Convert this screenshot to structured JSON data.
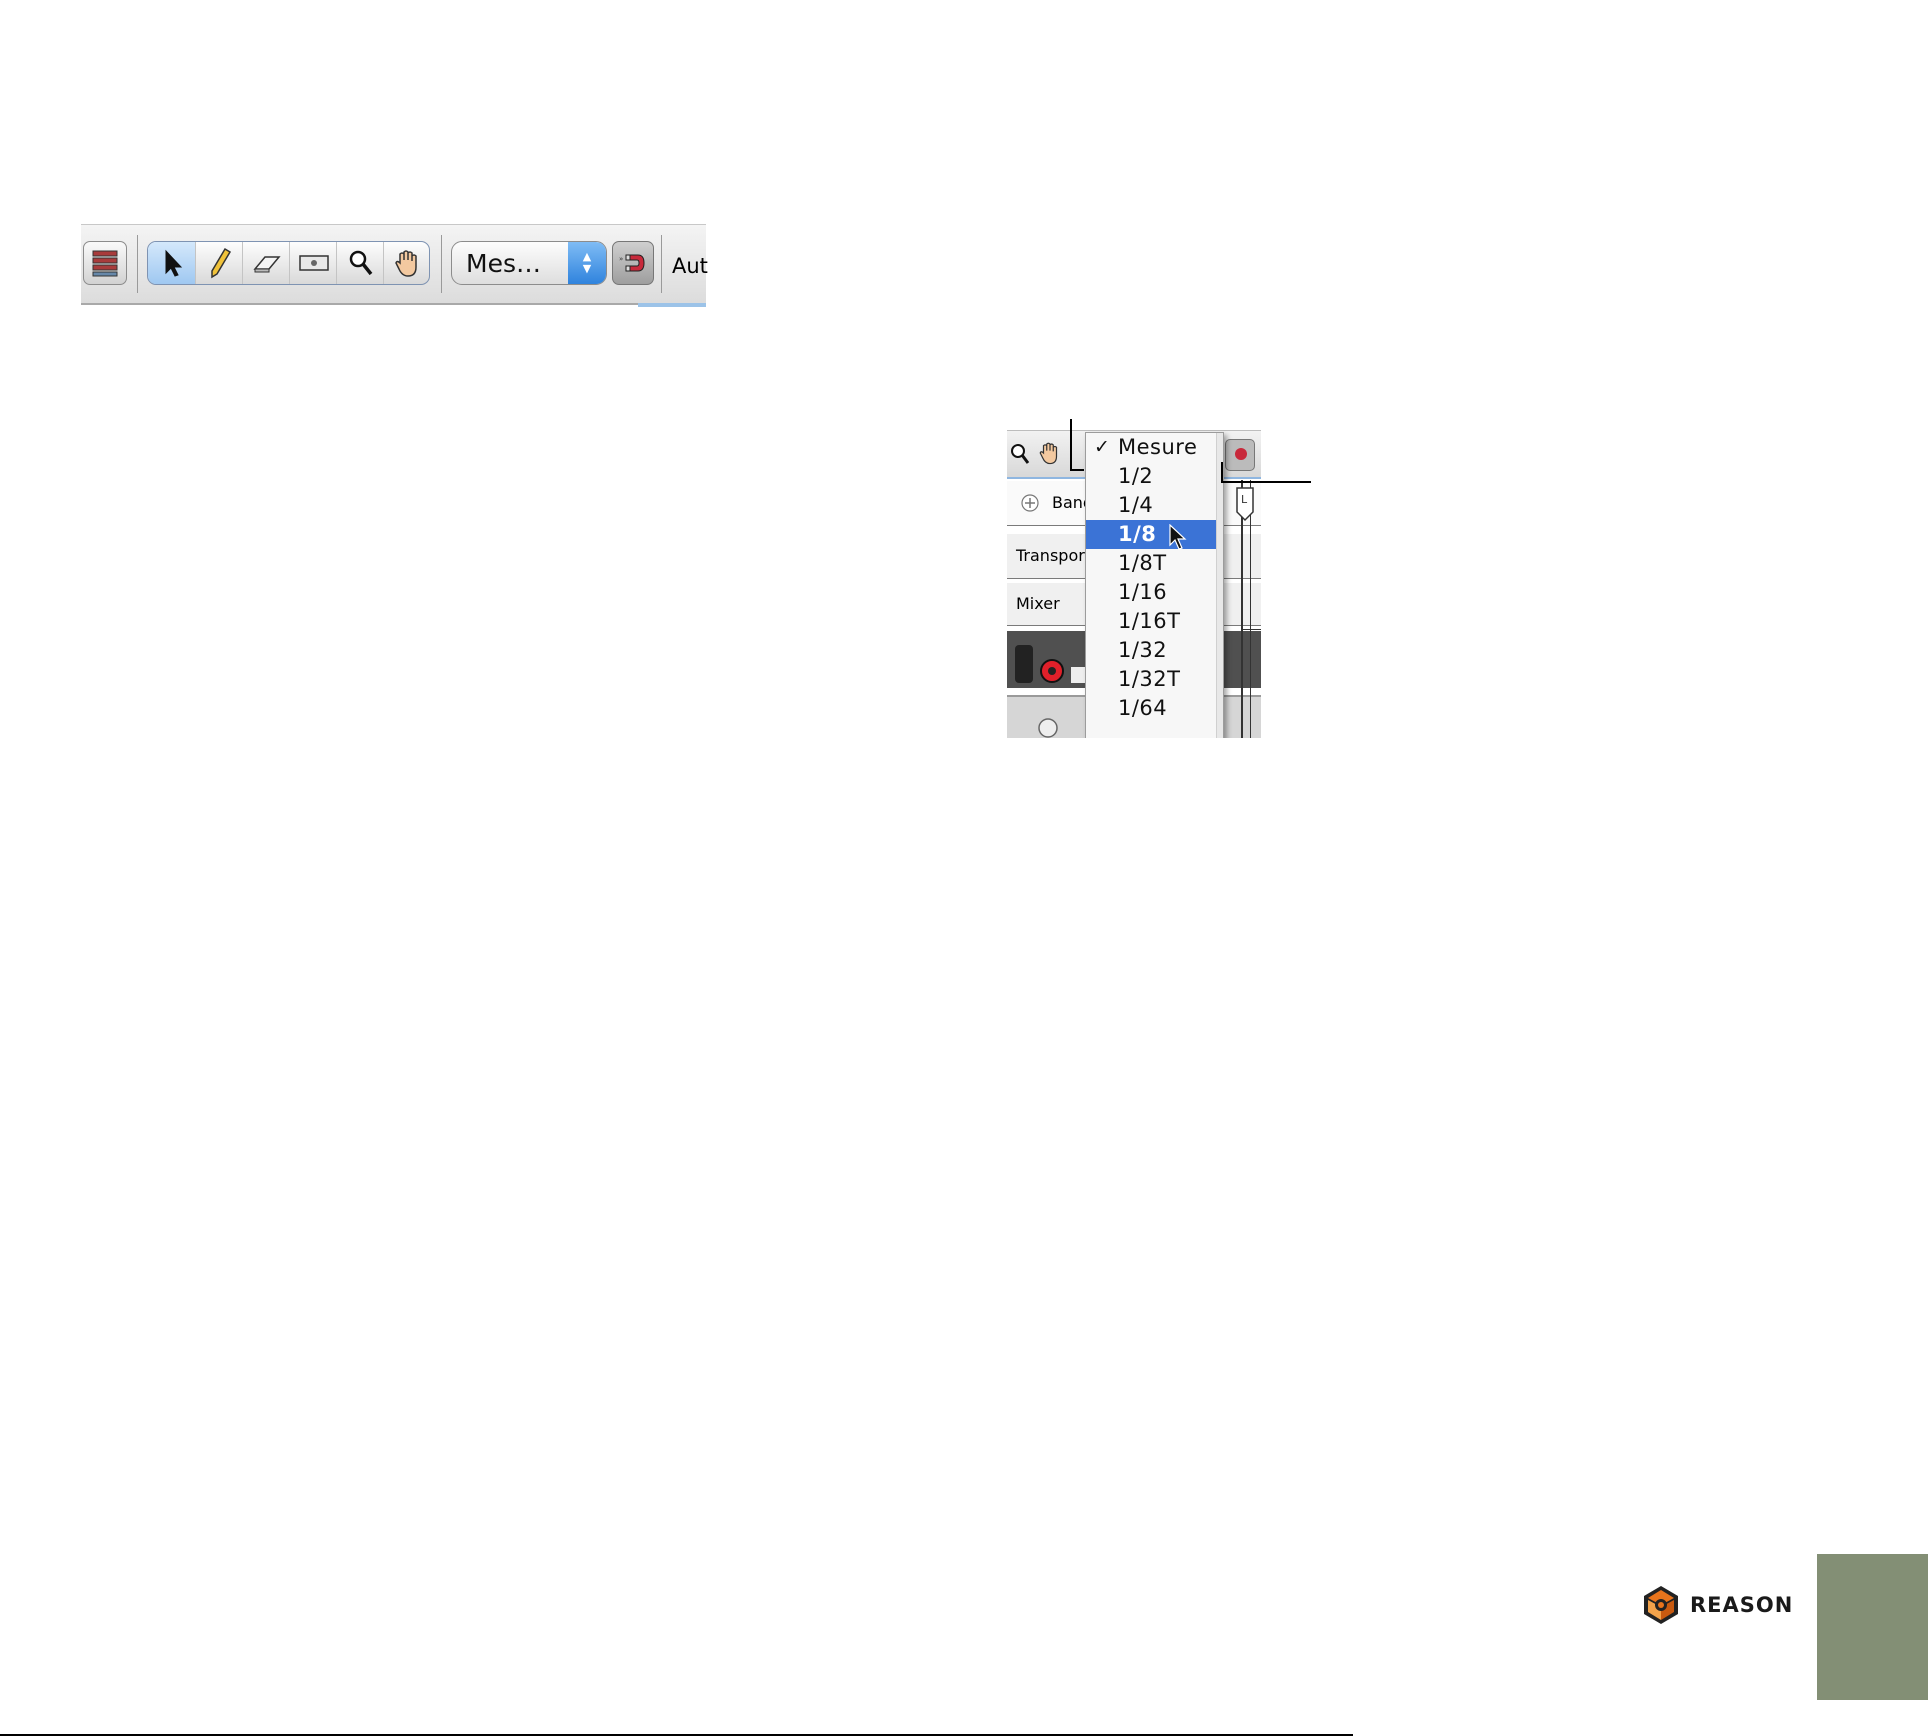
{
  "toolbar": {
    "snap_value": "Mes…",
    "auto_label": "Aut",
    "tools": [
      "arrow-icon",
      "pencil-icon",
      "eraser-icon",
      "razor-icon",
      "magnify-icon",
      "hand-icon"
    ]
  },
  "figure2": {
    "row_labels": {
      "bands": "Bandes",
      "transport": "Transpor",
      "mixer": "Mixer"
    },
    "menu": {
      "items": [
        "Mesure",
        "1/2",
        "1/4",
        "1/8",
        "1/8T",
        "1/16",
        "1/16T",
        "1/32",
        "1/32T",
        "1/64"
      ],
      "checked": "Mesure",
      "highlighted": "1/8"
    }
  },
  "footer": {
    "logo_text": "REASON",
    "tab_color": "#838f75"
  }
}
